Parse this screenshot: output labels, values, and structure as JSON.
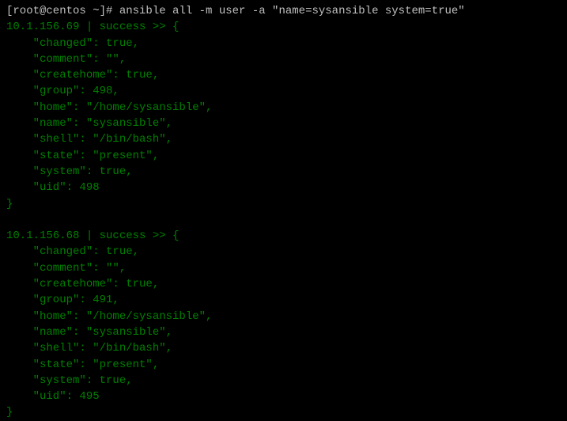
{
  "prompt": {
    "prefix": "[root@centos ~]# ",
    "command": "ansible all -m user -a \"name=sysansible system=true\""
  },
  "results": [
    {
      "host": "10.1.156.69",
      "status": "success",
      "header_suffix": " | success >> {",
      "lines": [
        "    \"changed\": true, ",
        "    \"comment\": \"\", ",
        "    \"createhome\": true, ",
        "    \"group\": 498, ",
        "    \"home\": \"/home/sysansible\", ",
        "    \"name\": \"sysansible\", ",
        "    \"shell\": \"/bin/bash\", ",
        "    \"state\": \"present\", ",
        "    \"system\": true, ",
        "    \"uid\": 498"
      ],
      "close": "}"
    },
    {
      "host": "10.1.156.68",
      "status": "success",
      "header_suffix": " | success >> {",
      "lines": [
        "    \"changed\": true, ",
        "    \"comment\": \"\", ",
        "    \"createhome\": true, ",
        "    \"group\": 491, ",
        "    \"home\": \"/home/sysansible\", ",
        "    \"name\": \"sysansible\", ",
        "    \"shell\": \"/bin/bash\", ",
        "    \"state\": \"present\", ",
        "    \"system\": true, ",
        "    \"uid\": 495"
      ],
      "close": "}"
    }
  ]
}
